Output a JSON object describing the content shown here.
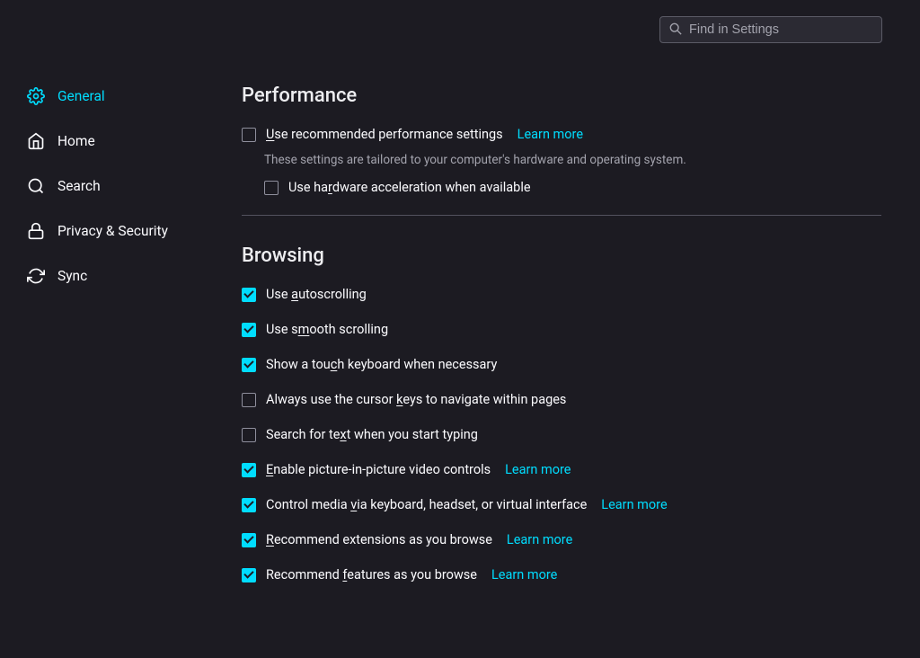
{
  "search": {
    "placeholder": "Find in Settings"
  },
  "sidebar": {
    "items": [
      {
        "label": "General"
      },
      {
        "label": "Home"
      },
      {
        "label": "Search"
      },
      {
        "label": "Privacy & Security"
      },
      {
        "label": "Sync"
      }
    ]
  },
  "performance": {
    "title": "Performance",
    "use_recommended": {
      "prefix": "U",
      "rest": "se recommended performance settings",
      "learn_more": "Learn more"
    },
    "subtext": "These settings are tailored to your computer's hardware and operating system.",
    "hw_accel": {
      "prefix": "Use ha",
      "underline": "r",
      "rest": "dware acceleration when available"
    }
  },
  "browsing": {
    "title": "Browsing",
    "autoscroll": {
      "prefix": "Use ",
      "underline": "a",
      "rest": "utoscrolling"
    },
    "smooth": {
      "prefix": "Use s",
      "underline": "m",
      "rest": "ooth scrolling"
    },
    "touch": {
      "prefix": "Show a tou",
      "underline": "c",
      "rest": "h keyboard when necessary"
    },
    "cursor": {
      "prefix": "Always use the cursor ",
      "underline": "k",
      "rest": "eys to navigate within pages"
    },
    "search_text": {
      "prefix": "Search for te",
      "underline": "x",
      "rest": "t when you start typing"
    },
    "pip": {
      "prefix": "E",
      "underline": "",
      "rest": "nable picture-in-picture video controls",
      "learn_more": "Learn more",
      "leading_underline": true
    },
    "media": {
      "prefix": "Control media ",
      "underline": "v",
      "rest": "ia keyboard, headset, or virtual interface",
      "learn_more": "Learn more"
    },
    "extensions": {
      "prefix": "R",
      "underline": "",
      "rest": "ecommend extensions as you browse",
      "learn_more": "Learn more",
      "leading_underline": true
    },
    "features": {
      "prefix": "Recommend ",
      "underline": "f",
      "rest": "eatures as you browse",
      "learn_more": "Learn more"
    }
  }
}
